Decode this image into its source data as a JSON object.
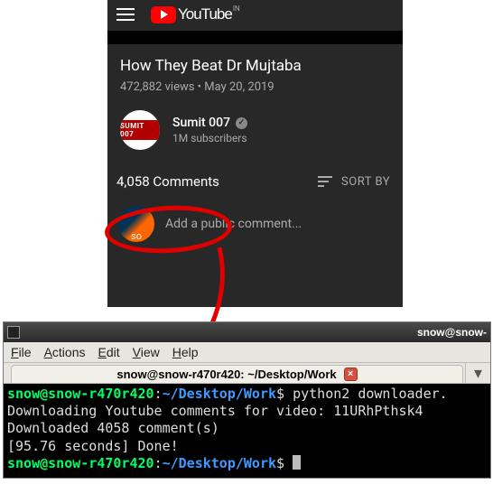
{
  "youtube": {
    "brand": "YouTube",
    "region": "IN",
    "video_title": "How They Beat Dr Mujtaba",
    "views": "472,882 views",
    "date": "May 20, 2019",
    "meta_sep": " • ",
    "channel": {
      "avatar_text": "SUMIT 007",
      "name": "Sumit 007",
      "subscribers": "1M subscribers"
    },
    "comments_count": "4,058 Comments",
    "sort_label": "SORT BY",
    "comment_placeholder": "Add a public comment...",
    "user_avatar_text": "so"
  },
  "terminal": {
    "window_title": "snow@snow-",
    "menu": {
      "file": "File",
      "actions": "Actions",
      "edit": "Edit",
      "view": "View",
      "help": "Help"
    },
    "tab_title": "snow@snow-r470r420: ~/Desktop/Work",
    "prompt": {
      "user": "snow@snow-r470r420",
      "sep": ":",
      "path": "~/Desktop/Work",
      "end": "$ "
    },
    "cmd": "python2 downloader.",
    "out1": "Downloading Youtube comments for video: 11URhPthsk4",
    "out2": "Downloaded 4058 comment(s)",
    "out3": "[95.76 seconds] Done!"
  }
}
